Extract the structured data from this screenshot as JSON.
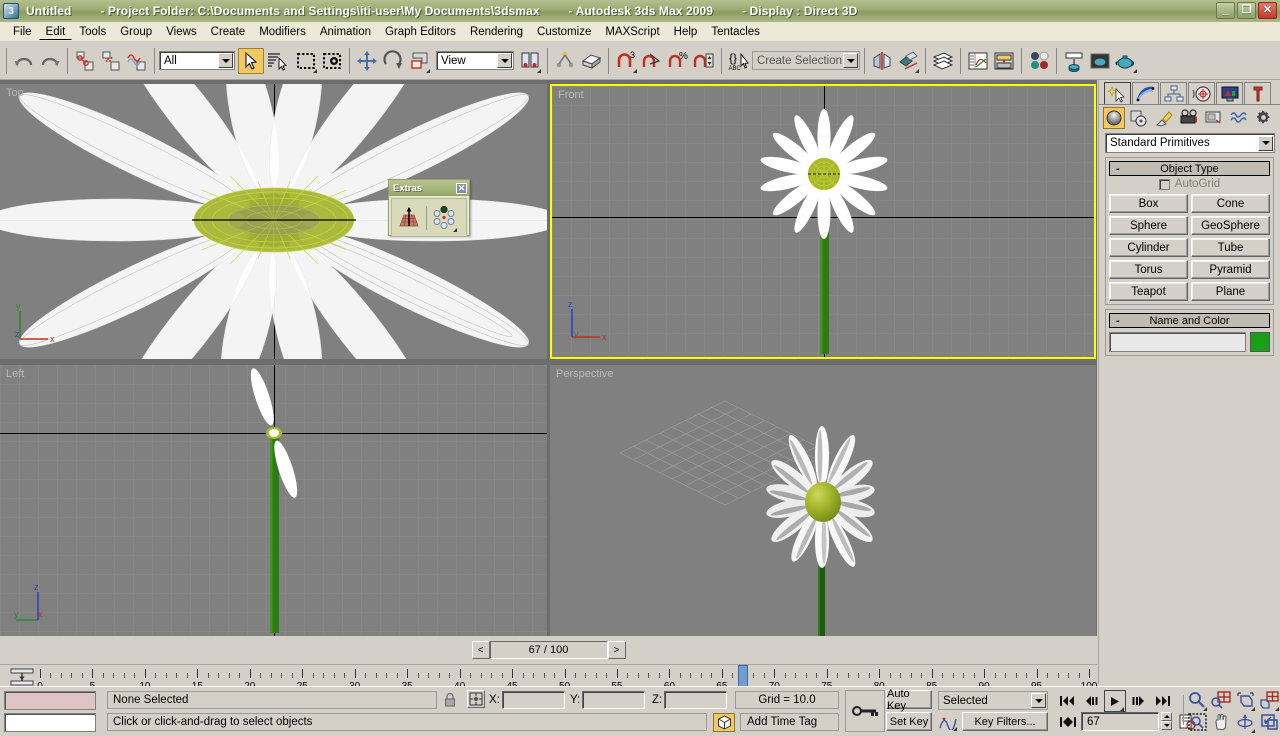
{
  "titlebar": {
    "app_icon": "3dsmax-logo-icon",
    "file_name": "Untitled",
    "project_folder": "- Project Folder: C:\\Documents and Settings\\iti-user\\My Documents\\3dsmax",
    "product": "- Autodesk 3ds Max  2009",
    "display": "- Display : Direct 3D",
    "minimize": "_",
    "restore": "❐",
    "close": "✕"
  },
  "menubar": {
    "items": [
      {
        "label": "File",
        "active": false
      },
      {
        "label": "Edit",
        "active": true
      },
      {
        "label": "Tools",
        "active": false
      },
      {
        "label": "Group",
        "active": false
      },
      {
        "label": "Views",
        "active": false
      },
      {
        "label": "Create",
        "active": false
      },
      {
        "label": "Modifiers",
        "active": false
      },
      {
        "label": "Animation",
        "active": false
      },
      {
        "label": "Graph Editors",
        "active": false
      },
      {
        "label": "Rendering",
        "active": false
      },
      {
        "label": "Customize",
        "active": false
      },
      {
        "label": "MAXScript",
        "active": false
      },
      {
        "label": "Help",
        "active": false
      },
      {
        "label": "Tentacles",
        "active": false
      }
    ]
  },
  "toolbar": {
    "undo": "undo-icon",
    "redo": "redo-icon",
    "select_and_link": "select-and-link-icon",
    "unlink_selection": "unlink-selection-icon",
    "bind_to_space_warp": "bind-to-space-warp-icon",
    "selection_filter_value": "All",
    "select_object": "select-object-arrow-icon",
    "select_by_name": "select-by-name-icon",
    "rectangular_selection_region": "rectangular-selection-region-icon",
    "window_crossing": "window-crossing-icon",
    "select_and_move": "select-and-move-icon",
    "select_and_rotate": "select-and-rotate-icon",
    "select_and_scale": "select-and-scale-icon",
    "reference_coordinate_system_value": "View",
    "use_pivot_point_center": "use-pivot-point-center-icon",
    "select_and_manipulate": "select-and-manipulate-icon",
    "keyboard_shortcut_override": "keyboard-shortcut-override-icon",
    "snaps_toggle": "snaps-toggle-3-icon",
    "angle_snap_toggle": "angle-snap-toggle-icon",
    "percent_snap_toggle": "percent-snap-toggle-icon",
    "spinner_snap_toggle": "spinner-snap-toggle-icon",
    "named_selection_sets": "named-selection-sets-icon",
    "selection_set_placeholder": "Create Selection Set",
    "mirror": "mirror-icon",
    "align": "align-icon",
    "layer_manager": "layer-manager-icon",
    "curve_editor": "curve-editor-icon",
    "schematic_view": "schematic-view-icon",
    "material_editor": "material-editor-icon",
    "render_setup": "render-setup-icon",
    "rendered_frame_window": "rendered-frame-window-icon",
    "render_production": "render-production-teapot-icon"
  },
  "viewports": [
    {
      "name": "Top",
      "label": "Top",
      "active": false
    },
    {
      "name": "Front",
      "label": "Front",
      "active": true
    },
    {
      "name": "Left",
      "label": "Left",
      "active": false
    },
    {
      "name": "Perspective",
      "label": "Perspective",
      "active": false
    }
  ],
  "extras_floater": {
    "title": "Extras",
    "close": "✕",
    "array_icon": "array-icon",
    "snapshot_icon": "spacing-tool-icon"
  },
  "command_panel": {
    "tabs": [
      {
        "name": "create",
        "icon": "create-star-arrow-icon",
        "selected": true
      },
      {
        "name": "modify",
        "icon": "modify-curve-icon",
        "selected": false
      },
      {
        "name": "hierarchy",
        "icon": "hierarchy-icon",
        "selected": false
      },
      {
        "name": "motion",
        "icon": "motion-wheel-icon",
        "selected": false
      },
      {
        "name": "display",
        "icon": "display-monitor-icon",
        "selected": false
      },
      {
        "name": "utilities",
        "icon": "utilities-hammer-icon",
        "selected": false
      }
    ],
    "subtabs": [
      {
        "name": "geometry",
        "icon": "geometry-sphere-icon",
        "selected": true
      },
      {
        "name": "shapes",
        "icon": "shapes-icon",
        "selected": false
      },
      {
        "name": "lights",
        "icon": "lights-icon",
        "selected": false
      },
      {
        "name": "cameras",
        "icon": "cameras-icon",
        "selected": false
      },
      {
        "name": "helpers",
        "icon": "helpers-icon",
        "selected": false
      },
      {
        "name": "space-warps",
        "icon": "space-warps-icon",
        "selected": false
      },
      {
        "name": "systems",
        "icon": "systems-gears-icon",
        "selected": false
      }
    ],
    "category_value": "Standard Primitives",
    "object_type": {
      "header": "Object Type",
      "collapse": "-",
      "autogrid_label": "AutoGrid",
      "autogrid_checked": false,
      "buttons": [
        "Box",
        "Cone",
        "Sphere",
        "GeoSphere",
        "Cylinder",
        "Tube",
        "Torus",
        "Pyramid",
        "Teapot",
        "Plane"
      ]
    },
    "name_and_color": {
      "header": "Name and Color",
      "collapse": "-",
      "name_value": "",
      "color": "#18a018"
    }
  },
  "time_slider": {
    "prev_label": "<",
    "next_label": ">",
    "value": "67 / 100",
    "current_frame": 67,
    "total_frames": 100
  },
  "track_ruler": {
    "icon": "open-track-view-icon",
    "ticks": [
      0,
      5,
      10,
      15,
      20,
      25,
      30,
      35,
      40,
      45,
      50,
      55,
      60,
      65,
      70,
      75,
      80,
      85,
      90,
      95,
      100
    ],
    "thumb_frame": 67
  },
  "status_bar": {
    "selection_status": "None Selected",
    "prompt": "Click or click-and-drag to select objects",
    "lock_icon": "lock-selection-icon",
    "absolute_mode_icon": "absolute-mode-transform-type-in-icon",
    "x_label": "X:",
    "x_value": "",
    "y_label": "Y:",
    "y_value": "",
    "z_label": "Z:",
    "z_value": "",
    "grid_text": "Grid = 10.0",
    "add_time_tag": "Add Time Tag",
    "add_time_tag_icon": "time-tag-cube-icon",
    "key_mode_icon": "key-mode-toggle-icon",
    "auto_key": "Auto Key",
    "set_key": "Set Key",
    "key_filter_set": "Selected",
    "key_filters": "Key Filters...",
    "curve_icon": "set-key-curve-icon"
  },
  "playback": {
    "go_to_start": "go-to-start-icon",
    "previous_frame": "previous-frame-icon",
    "play": "play-animation-icon",
    "next_frame": "next-frame-icon",
    "go_to_end": "go-to-end-icon",
    "key_mode_toggle": "key-mode-toggle-icon",
    "frame_value": "67",
    "time_configuration": "time-configuration-icon"
  },
  "viewport_nav": {
    "zoom": "zoom-icon",
    "zoom_all": "zoom-all-icon",
    "zoom_extents": "zoom-extents-icon",
    "zoom_extents_all": "zoom-extents-all-icon",
    "field_of_view": "field-of-view-region-zoom-icon",
    "pan_view": "pan-view-hand-icon",
    "arc_rotate": "arc-rotate-icon",
    "maximize_viewport_toggle": "maximize-viewport-toggle-icon"
  },
  "colors": {
    "title_bar_green": "#9fae74",
    "panel_gray": "#d4d0c8",
    "viewport_gray": "#808080",
    "active_viewport_border": "#ffff00",
    "active_button_yellow": "#f2c860",
    "flower_petal": "#ffffff",
    "flower_center": "#a8b828",
    "stem_green": "#2f7a14",
    "object_color": "#18a018"
  }
}
